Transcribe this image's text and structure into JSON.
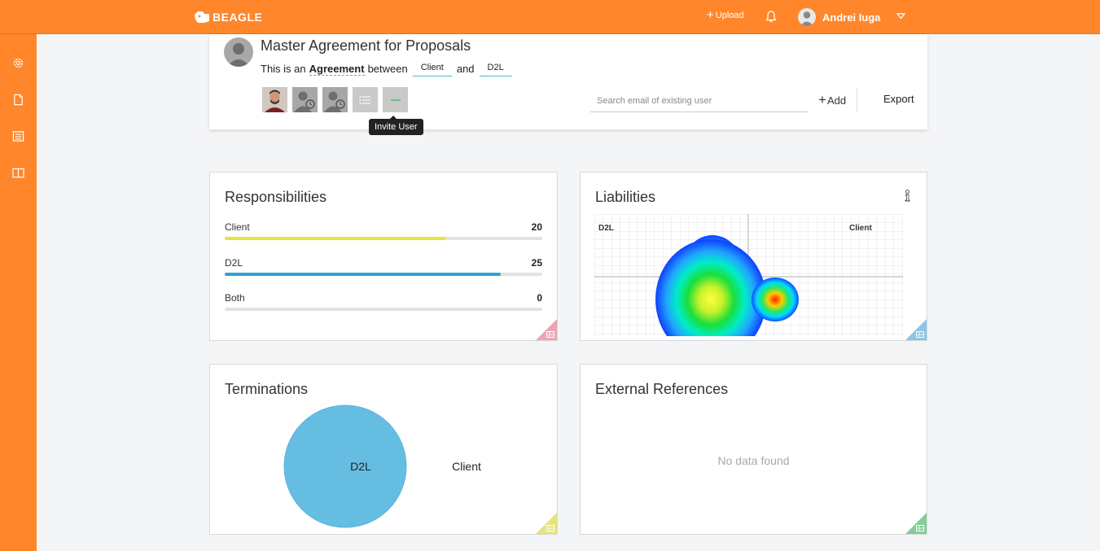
{
  "brand": {
    "name": "BEAGLE",
    "accent": "#ff862b"
  },
  "topbar": {
    "upload_label": "Upload",
    "user_name": "Andrei Iuga"
  },
  "sidebar": {
    "items": [
      "settings-icon",
      "document-icon",
      "list-icon",
      "book-icon"
    ]
  },
  "document": {
    "title": "Master Agreement for Proposals",
    "prefix": "This is an",
    "type": "Agreement",
    "between": "between",
    "party_a": "Client",
    "and": "and",
    "party_b": "D2L",
    "tooltip": "Invite User",
    "search_placeholder": "Search email of existing user",
    "add_label": "Add",
    "export_label": "Export"
  },
  "responsibilities": {
    "title": "Responsibilities",
    "rows": [
      {
        "label": "Client",
        "value": "20",
        "fill": 0.695,
        "color": "#e5e33f"
      },
      {
        "label": "D2L",
        "value": "25",
        "fill": 0.87,
        "color": "#2ea3d3"
      },
      {
        "label": "Both",
        "value": "0",
        "fill": 0,
        "color": "#2ea3d3"
      }
    ]
  },
  "liabilities": {
    "title": "Liabilities",
    "left_label": "D2L",
    "right_label": "Client",
    "bar_colors": [
      "#2ea3d3",
      "#e5e33f"
    ],
    "bar_split": 0.835
  },
  "terminations": {
    "title": "Terminations",
    "chart_data": {
      "type": "pie",
      "categories": [
        "D2L",
        "Client"
      ],
      "values": [
        100,
        0
      ],
      "colors": [
        "#66bde2",
        "#ffffff"
      ]
    }
  },
  "external_references": {
    "title": "External References",
    "empty_text": "No data found"
  }
}
